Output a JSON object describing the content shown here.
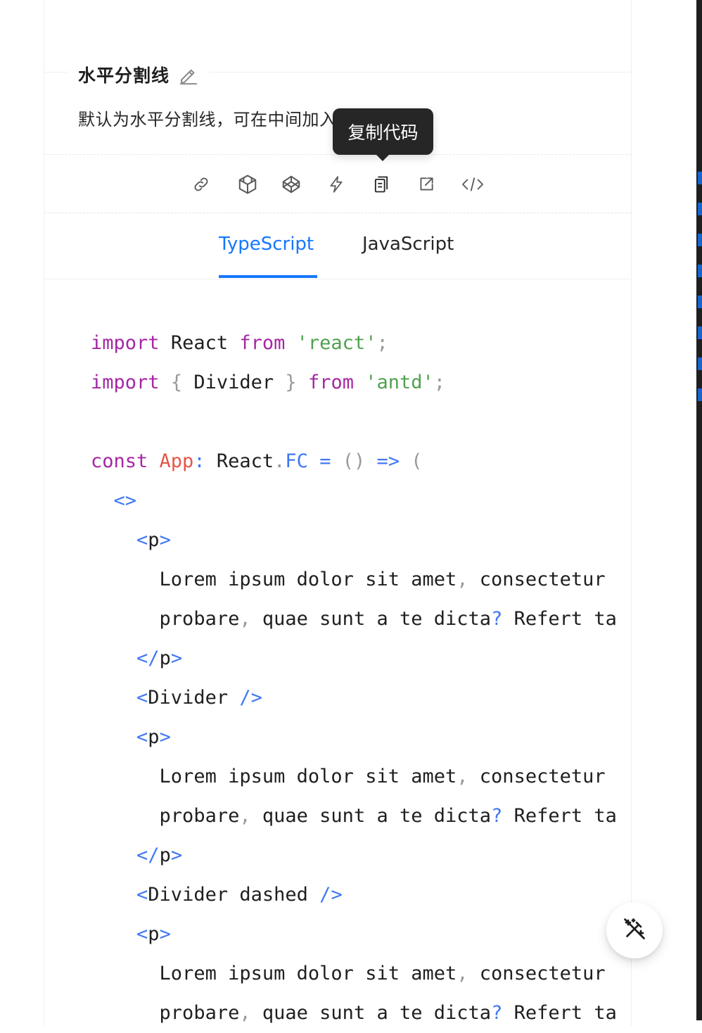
{
  "section": {
    "title": "水平分割线",
    "description": "默认为水平分割线，可在中间加入文字。"
  },
  "tooltip": {
    "text": "复制代码"
  },
  "actions": [
    {
      "name": "link-icon"
    },
    {
      "name": "codesandbox-icon"
    },
    {
      "name": "codepen-icon"
    },
    {
      "name": "stackblitz-icon"
    },
    {
      "name": "copy-icon"
    },
    {
      "name": "open-in-new-window-icon"
    },
    {
      "name": "code-icon"
    }
  ],
  "tabs": [
    {
      "label": "TypeScript",
      "active": true
    },
    {
      "label": "JavaScript",
      "active": false
    }
  ],
  "code_lines": [
    "import React from 'react';",
    "import { Divider } from 'antd';",
    "",
    "const App: React.FC = () => (",
    "  <>",
    "    <p>",
    "      Lorem ipsum dolor sit amet, consectetur",
    "      probare, quae sunt a te dicta? Refert ta",
    "    </p>",
    "    <Divider />",
    "    <p>",
    "      Lorem ipsum dolor sit amet, consectetur",
    "      probare, quae sunt a te dicta? Refert ta",
    "    </p>",
    "    <Divider dashed />",
    "    <p>",
    "      Lorem ipsum dolor sit amet, consectetur",
    "      probare, quae sunt a te dicta? Refert ta"
  ],
  "colors": {
    "accent": "#1677ff",
    "keyword": "#a626a4",
    "string": "#50a14f",
    "tag": "#4078f2",
    "identifier": "#e45649"
  },
  "fab": {
    "icon": "magic-wand-icon"
  }
}
